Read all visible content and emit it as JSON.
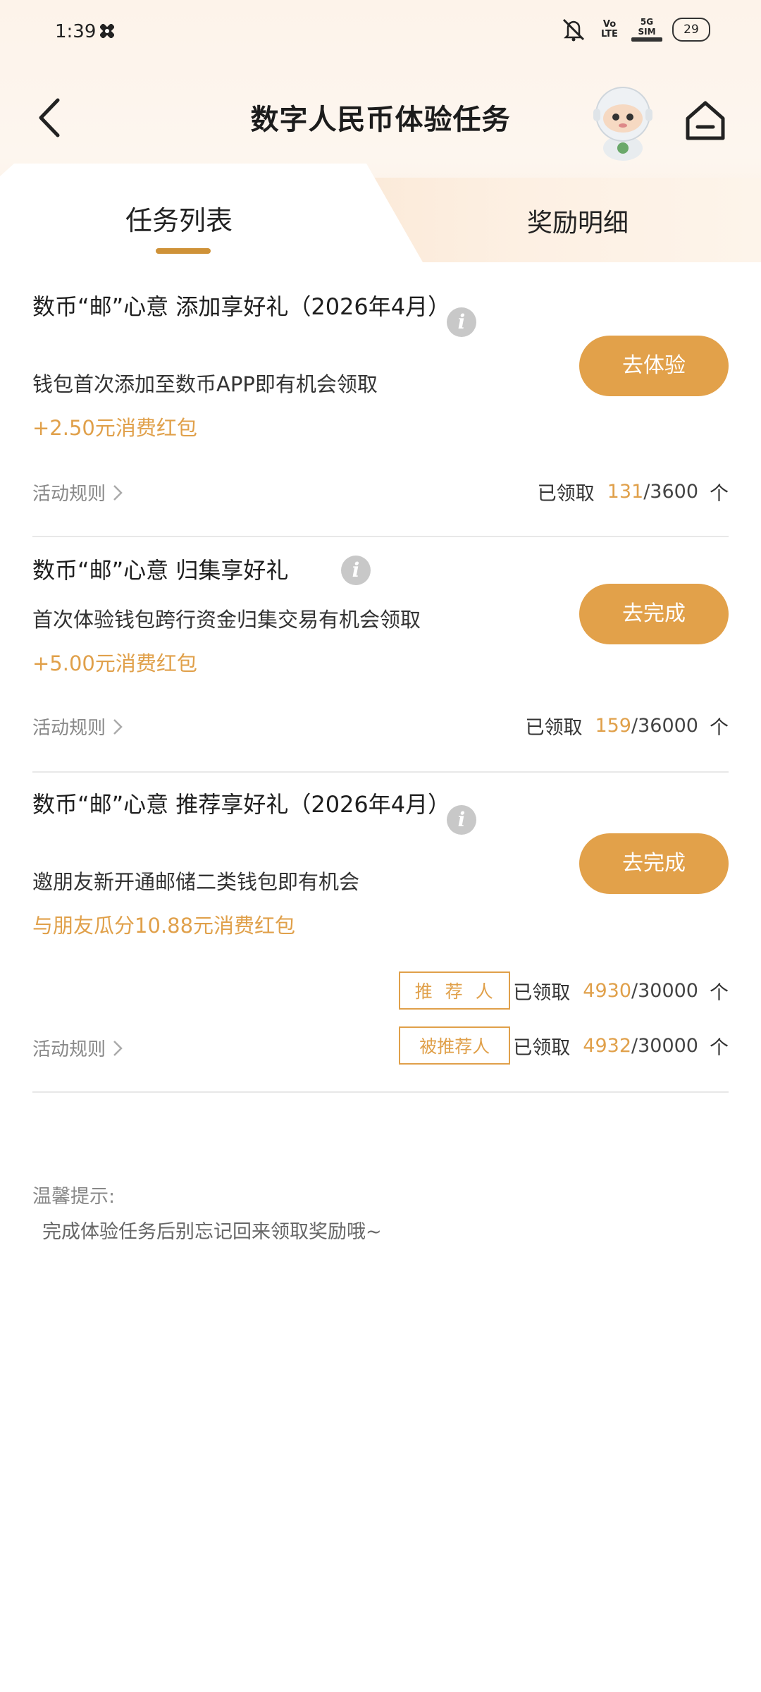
{
  "status": {
    "time": "1:39",
    "network": "5G",
    "sim": "SIM",
    "volte": "Vo LTE",
    "battery": "29"
  },
  "header": {
    "title": "数字人民币体验任务"
  },
  "tabs": [
    {
      "label": "任务列表",
      "active": true
    },
    {
      "label": "奖励明细",
      "active": false
    }
  ],
  "tasks": [
    {
      "title": "数币“邮”心意 添加享好礼（2026年4月）",
      "desc": "钱包首次添加至数币APP即有机会领取",
      "reward": "+2.50元消费红包",
      "button": "去体验",
      "rules": "活动规则",
      "claimed_label": "已领取",
      "claimed": "131",
      "total": "/3600",
      "unit": "个"
    },
    {
      "title": "数币“邮”心意 归集享好礼",
      "desc": "首次体验钱包跨行资金归集交易有机会领取",
      "reward": "+5.00元消费红包",
      "button": "去完成",
      "rules": "活动规则",
      "claimed_label": "已领取",
      "claimed": "159",
      "total": "/36000",
      "unit": "个"
    },
    {
      "title": "数币“邮”心意 推荐享好礼（2026年4月）",
      "desc": "邀朋友新开通邮储二类钱包即有机会",
      "reward": "与朋友瓜分10.88元消费红包",
      "button": "去完成",
      "rules": "活动规则",
      "roles": [
        {
          "tag": "推荐人",
          "claimed_label": "已领取",
          "claimed": "4930",
          "total": "/30000",
          "unit": "个"
        },
        {
          "tag": "被推荐人",
          "claimed_label": "已领取",
          "claimed": "4932",
          "total": "/30000",
          "unit": "个"
        }
      ]
    }
  ],
  "tips": {
    "title": "温馨提示:",
    "text": "完成体验任务后别忘记回来领取奖励哦~"
  },
  "colors": {
    "accent": "#e2a14a",
    "indicator": "#cf9238",
    "header_bg": "#fdf3ea"
  },
  "icons": [
    "back-arrow-icon",
    "home-icon",
    "mascot-robot-icon",
    "info-icon",
    "chevron-right-icon",
    "mute-icon",
    "battery-icon"
  ]
}
